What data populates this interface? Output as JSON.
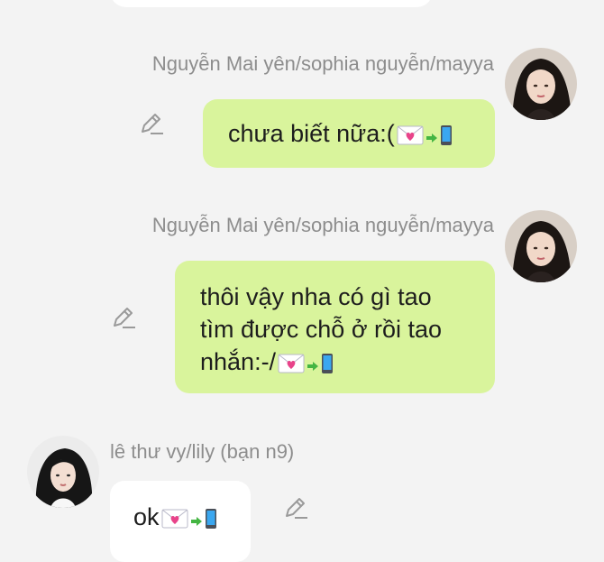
{
  "messages": [
    {
      "sender": "Nguyễn Mai yên/sophia nguyễn/mayya",
      "text": "chưa biết nữa:(",
      "emojis": [
        "love-letter-icon",
        "arrow-right-icon",
        "mobile-phone-icon"
      ]
    },
    {
      "sender": "Nguyễn Mai yên/sophia nguyễn/mayya",
      "lines": [
        "thôi vậy nha có gì tao",
        "tìm được chỗ ở rồi tao",
        "nhắn:-/"
      ],
      "emojis": [
        "love-letter-icon",
        "arrow-right-icon",
        "mobile-phone-icon"
      ]
    },
    {
      "sender": "lê thư vy/lily (bạn n9)",
      "text": "ok",
      "emojis": [
        "love-letter-icon",
        "arrow-right-icon",
        "mobile-phone-icon"
      ]
    }
  ],
  "colors": {
    "background": "#f3f3f3",
    "own_bubble": "#d9f49c",
    "other_bubble": "#ffffff",
    "sender_name": "#8d8d8d"
  }
}
